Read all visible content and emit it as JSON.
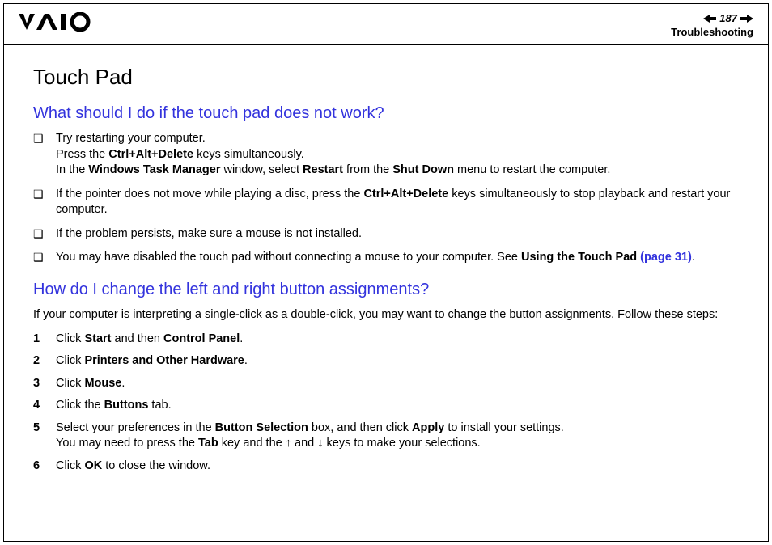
{
  "header": {
    "page_number": "187",
    "section": "Troubleshooting"
  },
  "title": "Touch Pad",
  "q1": {
    "heading": "What should I do if the touch pad does not work?",
    "bullets": [
      {
        "line1": "Try restarting your computer.",
        "line2a": "Press the ",
        "line2b": "Ctrl+Alt+Delete",
        "line2c": " keys simultaneously.",
        "line3a": "In the ",
        "line3b": "Windows Task Manager",
        "line3c": " window, select ",
        "line3d": "Restart",
        "line3e": " from the ",
        "line3f": "Shut Down",
        "line3g": " menu to restart the computer."
      },
      {
        "t1": "If the pointer does not move while playing a disc, press the ",
        "t2": "Ctrl+Alt+Delete",
        "t3": " keys simultaneously to stop playback and restart your computer."
      },
      {
        "t1": "If the problem persists, make sure a mouse is not installed."
      },
      {
        "t1": "You may have disabled the touch pad without connecting a mouse to your computer. See ",
        "t2": "Using the Touch Pad",
        "link": " (page 31)",
        "t3": "."
      }
    ]
  },
  "q2": {
    "heading": "How do I change the left and right button assignments?",
    "intro": "If your computer is interpreting a single-click as a double-click, you may want to change the button assignments. Follow these steps:",
    "steps": [
      {
        "n": "1",
        "a": "Click ",
        "b": "Start",
        "c": " and then ",
        "d": "Control Panel",
        "e": "."
      },
      {
        "n": "2",
        "a": "Click ",
        "b": "Printers and Other Hardware",
        "c": "."
      },
      {
        "n": "3",
        "a": "Click ",
        "b": "Mouse",
        "c": "."
      },
      {
        "n": "4",
        "a": "Click the ",
        "b": "Buttons",
        "c": " tab."
      },
      {
        "n": "5",
        "a": "Select your preferences in the ",
        "b": "Button Selection",
        "c": " box, and then click ",
        "d": "Apply",
        "e": " to install your settings.",
        "l2a": "You may need to press the ",
        "l2b": "Tab",
        "l2c": " key and the ",
        "up": "↑",
        "l2d": " and ",
        "down": "↓",
        "l2e": " keys to make your selections."
      },
      {
        "n": "6",
        "a": "Click ",
        "b": "OK",
        "c": " to close the window."
      }
    ]
  }
}
